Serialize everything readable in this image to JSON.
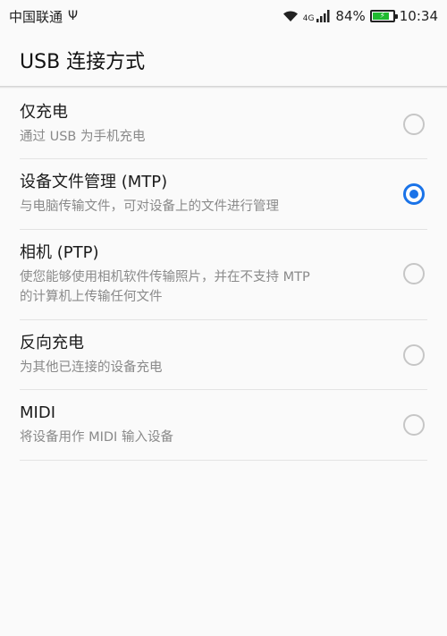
{
  "status_bar": {
    "carrier": "中国联通",
    "usb_symbol": "Ψ",
    "network_type": "4G",
    "battery_percent": "84%",
    "battery_level": 0.84,
    "time": "10:34",
    "icons": [
      "usb-icon",
      "wifi-icon",
      "signal-icon",
      "battery-charging-icon"
    ]
  },
  "header": {
    "title": "USB 连接方式"
  },
  "options": [
    {
      "title": "仅充电",
      "desc": "通过 USB 为手机充电",
      "selected": false
    },
    {
      "title": "设备文件管理 (MTP)",
      "desc": "与电脑传输文件，可对设备上的文件进行管理",
      "selected": true
    },
    {
      "title": "相机 (PTP)",
      "desc": "使您能够使用相机软件传输照片，并在不支持 MTP",
      "desc2": "的计算机上传输任何文件",
      "selected": false
    },
    {
      "title": "反向充电",
      "desc": "为其他已连接的设备充电",
      "selected": false
    },
    {
      "title": "MIDI",
      "desc": "将设备用作 MIDI 输入设备",
      "selected": false
    }
  ],
  "colors": {
    "accent": "#1a73e8",
    "battery": "#1fba2f",
    "background": "#fafafa"
  }
}
